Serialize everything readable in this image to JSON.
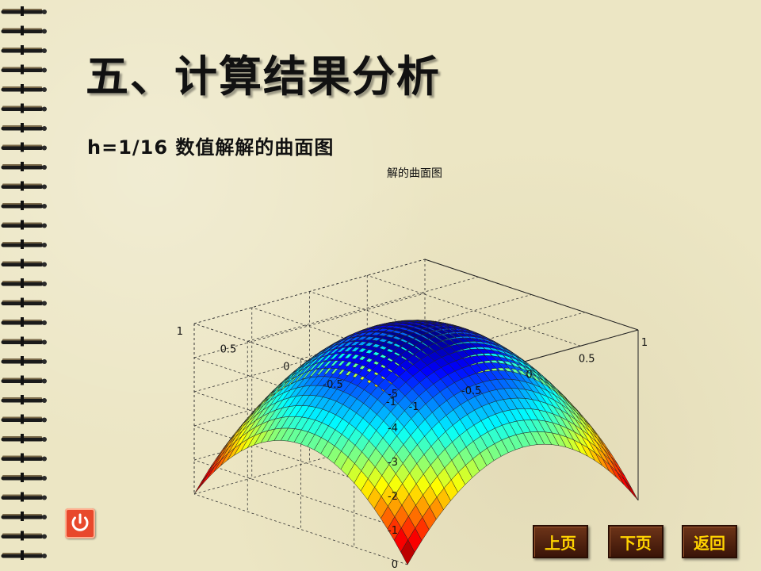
{
  "title": "五、计算结果分析",
  "subtitle": "h=1/16 数值解解的曲面图",
  "chart_data": {
    "type": "surface3d",
    "title": "解的曲面图",
    "x_ticks": [
      "-1",
      "-0.5",
      "0",
      "0.5",
      "1"
    ],
    "y_ticks": [
      "-1",
      "-0.5",
      "0",
      "0.5",
      "1"
    ],
    "z_ticks": [
      "0",
      "-1",
      "-2",
      "-3",
      "-4",
      "-5"
    ],
    "xlim": [
      -1,
      1
    ],
    "ylim": [
      -1,
      1
    ],
    "zlim": [
      -5,
      0
    ],
    "grid": true,
    "colormap": "jet",
    "surface": "z = 5*(x^2 - 1)/2 + 5*(y^2 - 1)/2 (bowl, min approx -5 at center, 0 at corners)"
  },
  "nav": {
    "prev": "上页",
    "next": "下页",
    "back": "返回"
  },
  "icons": {
    "power": "power-icon"
  },
  "colors": {
    "button_bg": "#4a1c0c",
    "button_text": "#ffd300",
    "power_bg": "#e8482c"
  }
}
